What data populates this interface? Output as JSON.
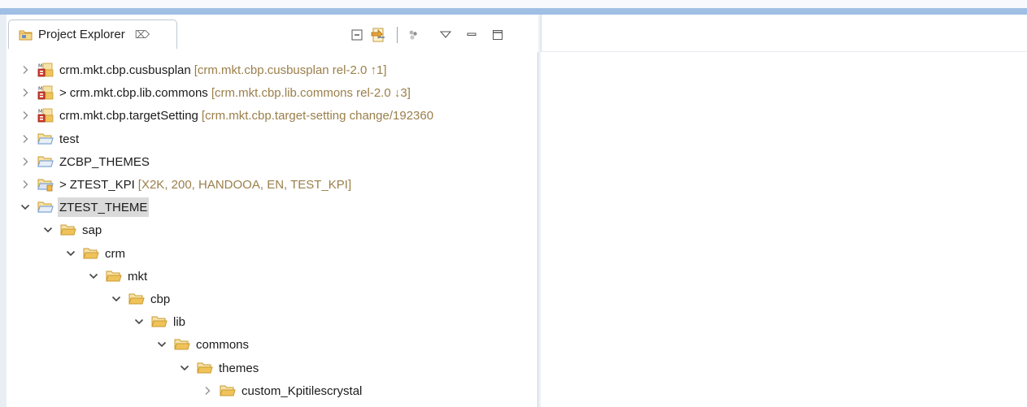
{
  "view": {
    "title": "Project Explorer",
    "close_glyph": "⌦",
    "toolbar": [
      "collapse-all-icon",
      "link-with-editor-icon",
      "filters-icon",
      "view-menu-icon",
      "minimize-icon",
      "maximize-icon"
    ]
  },
  "tree": [
    {
      "indent": 0,
      "expanded": false,
      "icon": "maven-project-icon",
      "prefix": "",
      "name": "crm.mkt.cbp.cusbusplan",
      "deco": "[crm.mkt.cbp.cusbusplan rel-2.0 ↑1]"
    },
    {
      "indent": 0,
      "expanded": false,
      "icon": "maven-project-icon",
      "prefix": ">",
      "name": "crm.mkt.cbp.lib.commons",
      "deco": "[crm.mkt.cbp.lib.commons rel-2.0 ↓3]"
    },
    {
      "indent": 0,
      "expanded": false,
      "icon": "maven-project-icon",
      "prefix": "",
      "name": "crm.mkt.cbp.targetSetting",
      "deco": "[crm.mkt.cbp.target-setting change/192360"
    },
    {
      "indent": 0,
      "expanded": false,
      "icon": "project-folder-icon",
      "prefix": "",
      "name": "test",
      "deco": ""
    },
    {
      "indent": 0,
      "expanded": false,
      "icon": "project-folder-icon",
      "prefix": "",
      "name": "ZCBP_THEMES",
      "deco": ""
    },
    {
      "indent": 0,
      "expanded": false,
      "icon": "bsp-project-icon",
      "prefix": ">",
      "name": "ZTEST_KPI",
      "deco": "[X2K, 200, HANDOOA, EN, TEST_KPI]"
    },
    {
      "indent": 0,
      "expanded": true,
      "icon": "project-folder-icon",
      "prefix": "",
      "name": "ZTEST_THEME",
      "deco": "",
      "selected": true
    },
    {
      "indent": 1,
      "expanded": true,
      "icon": "folder-icon",
      "prefix": "",
      "name": "sap",
      "deco": ""
    },
    {
      "indent": 2,
      "expanded": true,
      "icon": "folder-icon",
      "prefix": "",
      "name": "crm",
      "deco": ""
    },
    {
      "indent": 3,
      "expanded": true,
      "icon": "folder-icon",
      "prefix": "",
      "name": "mkt",
      "deco": ""
    },
    {
      "indent": 4,
      "expanded": true,
      "icon": "folder-icon",
      "prefix": "",
      "name": "cbp",
      "deco": ""
    },
    {
      "indent": 5,
      "expanded": true,
      "icon": "folder-icon",
      "prefix": "",
      "name": "lib",
      "deco": ""
    },
    {
      "indent": 6,
      "expanded": true,
      "icon": "folder-icon",
      "prefix": "",
      "name": "commons",
      "deco": ""
    },
    {
      "indent": 7,
      "expanded": true,
      "icon": "folder-icon",
      "prefix": "",
      "name": "themes",
      "deco": ""
    },
    {
      "indent": 8,
      "expanded": false,
      "icon": "folder-icon",
      "prefix": "",
      "name": "custom_Kpitilescrystal",
      "deco": ""
    }
  ],
  "colors": {
    "folder": "#f0c35a",
    "folder_dark": "#c99a2e",
    "project_folder": "#7fa7d8",
    "selection": "#dadada",
    "decoration": "#9a7f4a"
  }
}
